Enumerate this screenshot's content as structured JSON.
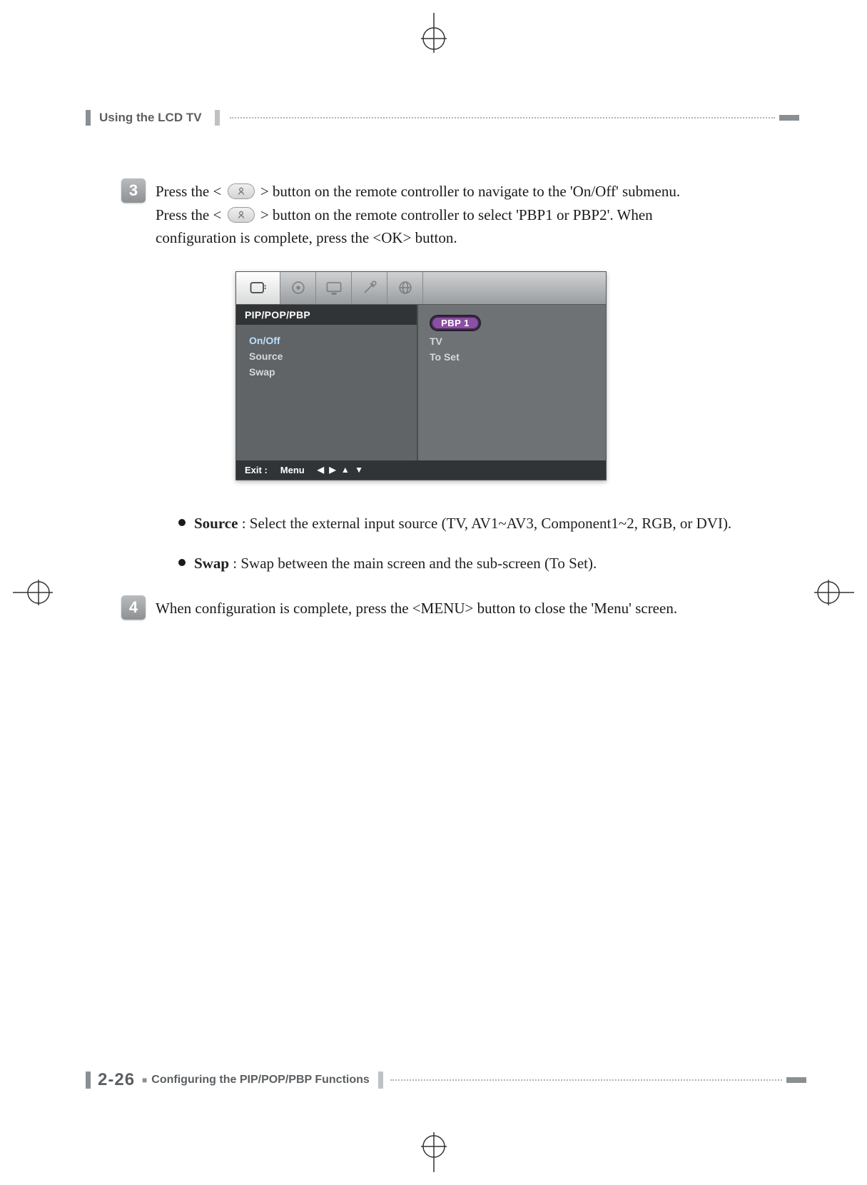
{
  "header": {
    "title": "Using the LCD TV"
  },
  "steps": {
    "s3": {
      "num": "3",
      "line1a": "Press the <",
      "line1b": "> button on the remote controller to navigate to the 'On/Off' submenu.",
      "line2a": "Press the <",
      "line2b": "> button on the remote controller to select 'PBP1 or PBP2'. When",
      "line3": "configuration is complete, press the <OK> button."
    },
    "s4": {
      "num": "4",
      "text": "When configuration is complete, press the <MENU> button to close the 'Menu' screen."
    }
  },
  "osd": {
    "title": "PIP/POP/PBP",
    "rows": [
      {
        "label": "On/Off",
        "value_badge": "PBP 1"
      },
      {
        "label": "Source",
        "value": "TV"
      },
      {
        "label": "Swap",
        "value": "To Set"
      }
    ],
    "footer": {
      "exit": "Exit :",
      "menu": "Menu",
      "arrows": "◀ ▶ ▲ ▼"
    }
  },
  "bullets": [
    {
      "label": "Source",
      "text": " : Select the external input source (TV, AV1~AV3, Component1~2, RGB, or DVI)."
    },
    {
      "label": "Swap",
      "text": " : Swap between the main screen and the sub-screen (To Set)."
    }
  ],
  "footer": {
    "pageno": "2-26",
    "square": "■",
    "title": "Configuring the PIP/POP/PBP Functions"
  }
}
